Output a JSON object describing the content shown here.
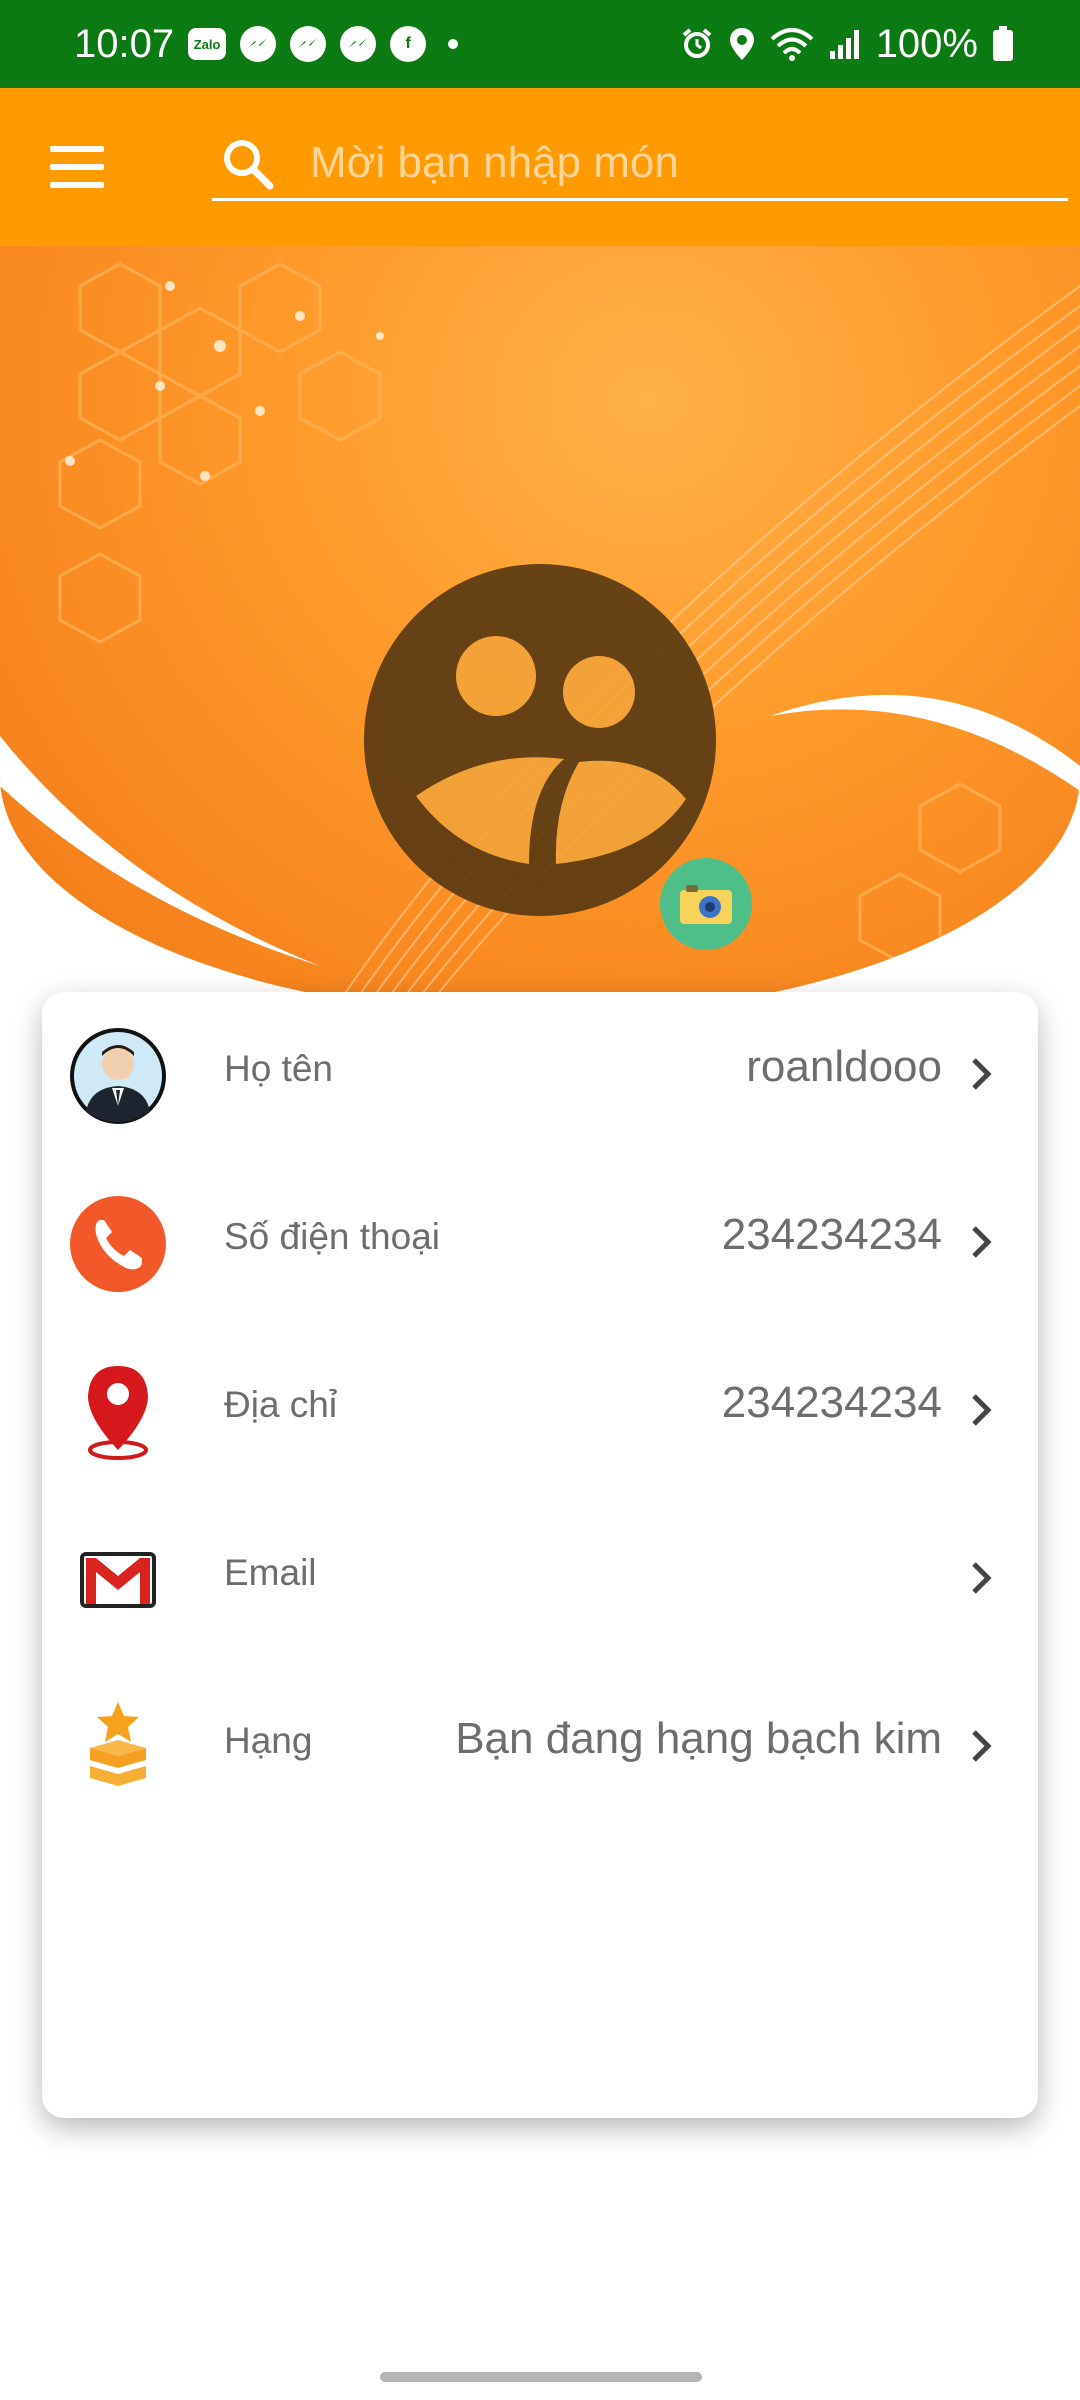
{
  "status_bar": {
    "time": "10:07",
    "battery": "100%",
    "notifications": [
      "Zalo",
      "messenger-icon",
      "messenger-icon",
      "messenger-icon",
      "facebook-icon"
    ],
    "system_icons": [
      "alarm-icon",
      "location-icon",
      "wifi-icon",
      "signal-icon",
      "battery-icon"
    ]
  },
  "search": {
    "placeholder": "Mời bạn nhập món",
    "value": ""
  },
  "profile": {
    "avatar_icon": "user-group-icon",
    "camera_icon": "camera-icon"
  },
  "info_rows": [
    {
      "icon": "user-avatar-icon",
      "label": "Họ tên",
      "value": "roanldooo"
    },
    {
      "icon": "phone-icon",
      "label": "Số điện thoại",
      "value": "234234234"
    },
    {
      "icon": "location-pin-icon",
      "label": "Địa chỉ",
      "value": "234234234"
    },
    {
      "icon": "gmail-icon",
      "label": "Email",
      "value": ""
    },
    {
      "icon": "rank-star-icon",
      "label": "Hạng",
      "value": "Bạn đang hạng bạch kim"
    }
  ],
  "colors": {
    "status_bar": "#0b7a12",
    "accent": "#ff9a00",
    "text_gray": "#6d6d6d"
  }
}
